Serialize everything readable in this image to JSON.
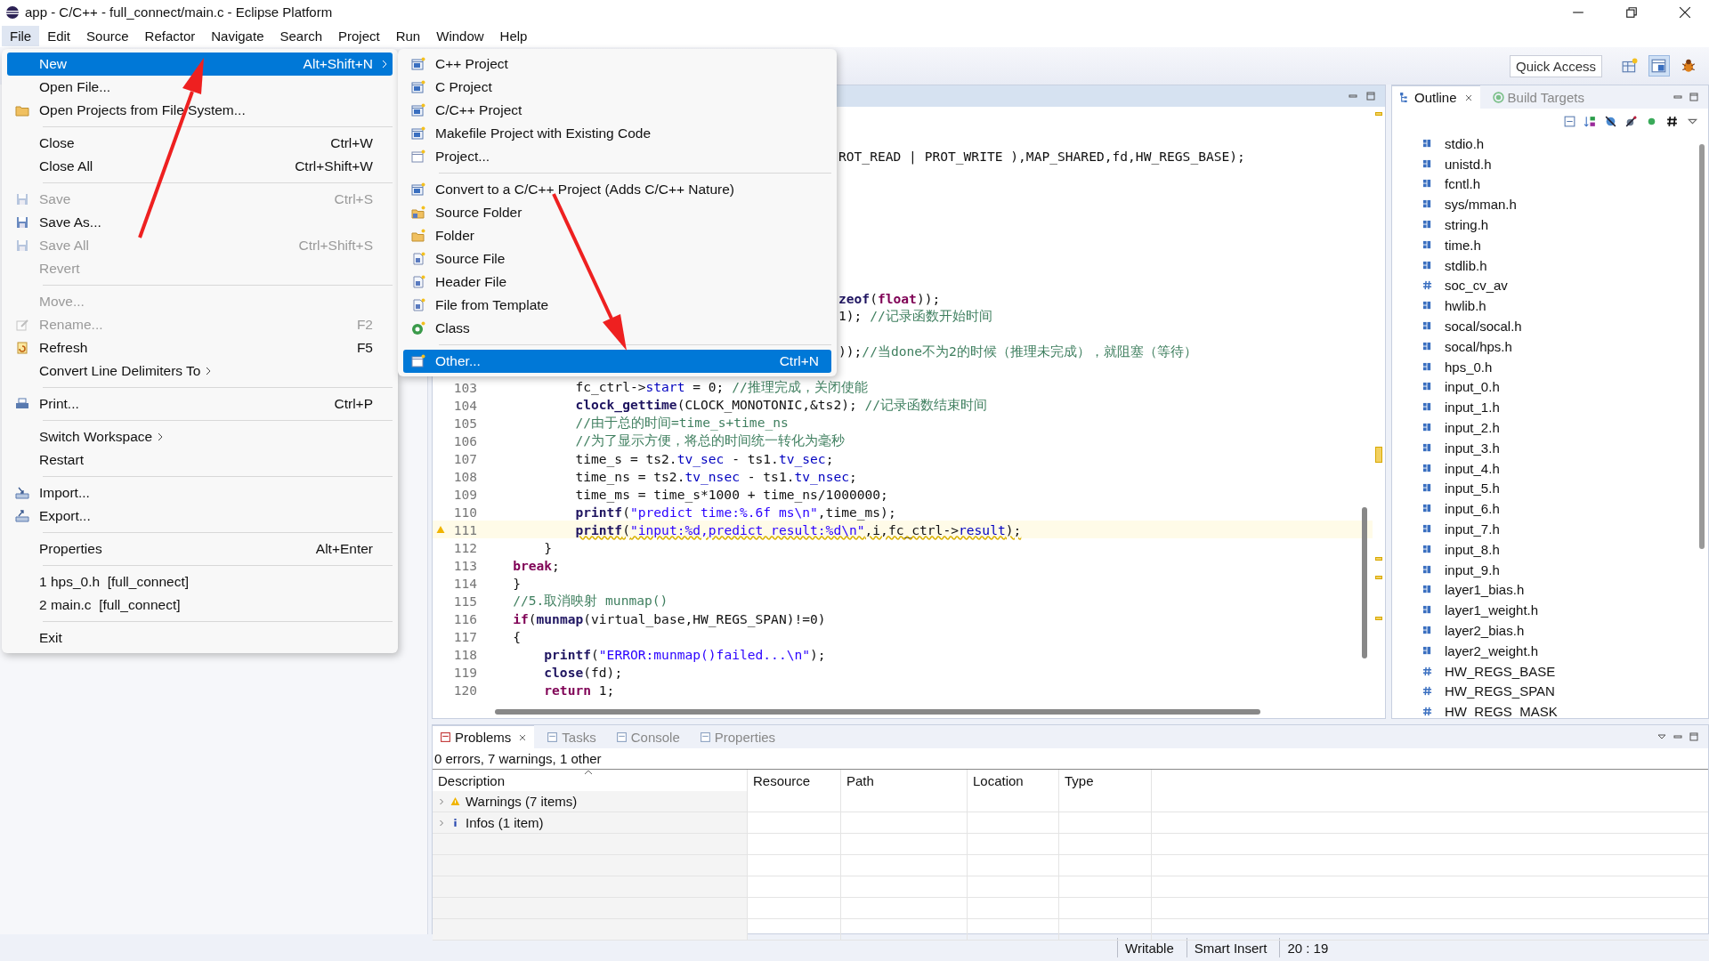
{
  "window": {
    "title": "app - C/C++ - full_connect/main.c - Eclipse Platform"
  },
  "menu_bar": [
    {
      "label": "File",
      "selected": true
    },
    {
      "label": "Edit",
      "selected": false
    },
    {
      "label": "Source",
      "selected": false
    },
    {
      "label": "Refactor",
      "selected": false
    },
    {
      "label": "Navigate",
      "selected": false
    },
    {
      "label": "Search",
      "selected": false
    },
    {
      "label": "Project",
      "selected": false
    },
    {
      "label": "Run",
      "selected": false
    },
    {
      "label": "Window",
      "selected": false
    },
    {
      "label": "Help",
      "selected": false
    }
  ],
  "toolbar": {
    "quick_access": "Quick Access"
  },
  "file_menu": [
    {
      "kind": "item",
      "label": "New",
      "shortcut": "Alt+Shift+N",
      "selected": true,
      "disabled": false,
      "has_submenu": true
    },
    {
      "kind": "item",
      "label": "Open File...",
      "selected": false,
      "disabled": false,
      "has_submenu": false
    },
    {
      "kind": "item",
      "label": "Open Projects from File System...",
      "selected": false,
      "disabled": false,
      "has_submenu": false
    },
    {
      "kind": "separator"
    },
    {
      "kind": "item",
      "label": "Close",
      "shortcut": "Ctrl+W",
      "selected": false,
      "disabled": false,
      "has_submenu": false
    },
    {
      "kind": "item",
      "label": "Close All",
      "shortcut": "Ctrl+Shift+W",
      "selected": false,
      "disabled": false,
      "has_submenu": false
    },
    {
      "kind": "separator"
    },
    {
      "kind": "item",
      "label": "Save",
      "shortcut": "Ctrl+S",
      "selected": false,
      "disabled": true,
      "has_submenu": false
    },
    {
      "kind": "item",
      "label": "Save As...",
      "selected": false,
      "disabled": false,
      "has_submenu": false
    },
    {
      "kind": "item",
      "label": "Save All",
      "shortcut": "Ctrl+Shift+S",
      "selected": false,
      "disabled": true,
      "has_submenu": false
    },
    {
      "kind": "item",
      "label": "Revert",
      "selected": false,
      "disabled": true,
      "has_submenu": false
    },
    {
      "kind": "separator"
    },
    {
      "kind": "item",
      "label": "Move...",
      "selected": false,
      "disabled": true,
      "has_submenu": false
    },
    {
      "kind": "item",
      "label": "Rename...",
      "shortcut": "F2",
      "selected": false,
      "disabled": true,
      "has_submenu": false
    },
    {
      "kind": "item",
      "label": "Refresh",
      "shortcut": "F5",
      "selected": false,
      "disabled": false,
      "has_submenu": false
    },
    {
      "kind": "item",
      "label": "Convert Line Delimiters To",
      "selected": false,
      "disabled": false,
      "has_submenu": true
    },
    {
      "kind": "separator"
    },
    {
      "kind": "item",
      "label": "Print...",
      "shortcut": "Ctrl+P",
      "selected": false,
      "disabled": false,
      "has_submenu": false
    },
    {
      "kind": "separator"
    },
    {
      "kind": "item",
      "label": "Switch Workspace",
      "selected": false,
      "disabled": false,
      "has_submenu": true
    },
    {
      "kind": "item",
      "label": "Restart",
      "selected": false,
      "disabled": false,
      "has_submenu": false
    },
    {
      "kind": "separator"
    },
    {
      "kind": "item",
      "label": "Import...",
      "selected": false,
      "disabled": false,
      "has_submenu": false
    },
    {
      "kind": "item",
      "label": "Export...",
      "selected": false,
      "disabled": false,
      "has_submenu": false
    },
    {
      "kind": "separator"
    },
    {
      "kind": "item",
      "label": "Properties",
      "shortcut": "Alt+Enter",
      "selected": false,
      "disabled": false,
      "has_submenu": false
    },
    {
      "kind": "separator"
    },
    {
      "kind": "item",
      "label": "1 hps_0.h  [full_connect]",
      "selected": false,
      "disabled": false,
      "has_submenu": false
    },
    {
      "kind": "item",
      "label": "2 main.c  [full_connect]",
      "selected": false,
      "disabled": false,
      "has_submenu": false
    },
    {
      "kind": "separator"
    },
    {
      "kind": "item",
      "label": "Exit",
      "selected": false,
      "disabled": false,
      "has_submenu": false
    }
  ],
  "new_submenu": [
    {
      "kind": "item",
      "label": "C++ Project",
      "selected": false
    },
    {
      "kind": "item",
      "label": "C Project",
      "selected": false
    },
    {
      "kind": "item",
      "label": "C/C++ Project",
      "selected": false
    },
    {
      "kind": "item",
      "label": "Makefile Project with Existing Code",
      "selected": false
    },
    {
      "kind": "item",
      "label": "Project...",
      "selected": false
    },
    {
      "kind": "separator"
    },
    {
      "kind": "item",
      "label": "Convert to a C/C++ Project (Adds C/C++ Nature)",
      "selected": false
    },
    {
      "kind": "item",
      "label": "Source Folder",
      "selected": false
    },
    {
      "kind": "item",
      "label": "Folder",
      "selected": false
    },
    {
      "kind": "item",
      "label": "Source File",
      "selected": false
    },
    {
      "kind": "item",
      "label": "Header File",
      "selected": false
    },
    {
      "kind": "item",
      "label": "File from Template",
      "selected": false
    },
    {
      "kind": "item",
      "label": "Class",
      "selected": false
    },
    {
      "kind": "separator"
    },
    {
      "kind": "item",
      "label": "Other...",
      "shortcut": "Ctrl+N",
      "selected": true
    }
  ],
  "editor": {
    "lines": [
      {
        "warning": false,
        "segments": [
          {
            "kind": "plain",
            "text": "ROT_READ | PROT_WRITE ),MAP_SHARED,fd,HW_REGS_BASE);"
          }
        ]
      },
      {
        "warning": false
      },
      {
        "warning": false
      },
      {
        "warning": false
      },
      {
        "warning": false
      },
      {
        "warning": false
      },
      {
        "warning": false
      },
      {
        "warning": false
      },
      {
        "warning": false,
        "segments": [
          {
            "kind": "function",
            "text": "zeof"
          },
          {
            "kind": "plain",
            "text": "("
          },
          {
            "kind": "keyword",
            "text": "float"
          },
          {
            "kind": "plain",
            "text": "));"
          }
        ]
      },
      {
        "warning": false,
        "segments": [
          {
            "kind": "plain",
            "text": "1); "
          },
          {
            "kind": "comment",
            "text": "//记录函数开始时间"
          }
        ]
      },
      {
        "warning": false
      },
      {
        "warning": false,
        "segments": [
          {
            "kind": "plain",
            "text": "));"
          },
          {
            "kind": "comment",
            "text": "//当done不为2的时候（推理未完成），就阻塞（等待）"
          }
        ]
      },
      {
        "warning": false
      },
      {
        "number": "103",
        "warning": false,
        "segments": [
          {
            "kind": "plain",
            "text": "\t\t\tfc_ctrl->"
          },
          {
            "kind": "field",
            "text": "start"
          },
          {
            "kind": "plain",
            "text": " = 0; "
          },
          {
            "kind": "comment",
            "text": "//推理完成，关闭使能"
          }
        ]
      },
      {
        "number": "104",
        "warning": false,
        "segments": [
          {
            "kind": "function",
            "text": "\t\t\tclock_gettime"
          },
          {
            "kind": "plain",
            "text": "(CLOCK_MONOTONIC,&ts2); "
          },
          {
            "kind": "comment",
            "text": "//记录函数结束时间"
          }
        ]
      },
      {
        "number": "105",
        "warning": false,
        "segments": [
          {
            "kind": "comment",
            "text": "\t\t\t//由于总的时间=time_s+time_ns"
          }
        ]
      },
      {
        "number": "106",
        "warning": false,
        "segments": [
          {
            "kind": "comment",
            "text": "\t\t\t//为了显示方便，将总的时间统一转化为毫秒"
          }
        ]
      },
      {
        "number": "107",
        "warning": false,
        "segments": [
          {
            "kind": "plain",
            "text": "\t\t\ttime_s = ts2."
          },
          {
            "kind": "field",
            "text": "tv_sec"
          },
          {
            "kind": "plain",
            "text": " - ts1."
          },
          {
            "kind": "field",
            "text": "tv_sec"
          },
          {
            "kind": "plain",
            "text": ";"
          }
        ]
      },
      {
        "number": "108",
        "warning": false,
        "segments": [
          {
            "kind": "plain",
            "text": "\t\t\ttime_ns = ts2."
          },
          {
            "kind": "field",
            "text": "tv_nsec"
          },
          {
            "kind": "plain",
            "text": " - ts1."
          },
          {
            "kind": "field",
            "text": "tv_nsec"
          },
          {
            "kind": "plain",
            "text": ";"
          }
        ]
      },
      {
        "number": "109",
        "warning": false,
        "segments": [
          {
            "kind": "plain",
            "text": "\t\t\ttime_ms = time_s*1000 + time_ns/1000000;"
          }
        ]
      },
      {
        "number": "110",
        "warning": false,
        "segments": [
          {
            "kind": "function",
            "text": "\t\t\tprintf"
          },
          {
            "kind": "plain",
            "text": "("
          },
          {
            "kind": "string",
            "text": "\"predict time:%.6f ms\\n\""
          },
          {
            "kind": "plain",
            "text": ",time_ms);"
          }
        ]
      },
      {
        "number": "111",
        "warning": true,
        "segments": [
          {
            "kind": "function",
            "text": "\t\t\tprintf"
          },
          {
            "kind": "plain",
            "text": "("
          },
          {
            "kind": "string",
            "text": "\"input:%d,predict result:%d\\n\""
          },
          {
            "kind": "plain",
            "text": ",i,fc_ctrl->"
          },
          {
            "kind": "field",
            "text": "result"
          },
          {
            "kind": "plain",
            "text": ");"
          }
        ]
      },
      {
        "number": "112",
        "warning": false,
        "segments": [
          {
            "kind": "plain",
            "text": "\t\t}"
          }
        ]
      },
      {
        "number": "113",
        "warning": false,
        "segments": [
          {
            "kind": "keyword",
            "text": "\tbreak"
          },
          {
            "kind": "plain",
            "text": ";"
          }
        ]
      },
      {
        "number": "114",
        "warning": false,
        "segments": [
          {
            "kind": "plain",
            "text": "\t}"
          }
        ]
      },
      {
        "number": "115",
        "warning": false,
        "segments": [
          {
            "kind": "comment",
            "text": "\t//5.取消映射 munmap()"
          }
        ]
      },
      {
        "number": "116",
        "warning": false,
        "segments": [
          {
            "kind": "keyword",
            "text": "\tif"
          },
          {
            "kind": "plain",
            "text": "("
          },
          {
            "kind": "function",
            "text": "munmap"
          },
          {
            "kind": "plain",
            "text": "(virtual_base,HW_REGS_SPAN)!=0)"
          }
        ]
      },
      {
        "number": "117",
        "warning": false,
        "segments": [
          {
            "kind": "plain",
            "text": "\t{"
          }
        ]
      },
      {
        "number": "118",
        "warning": false,
        "segments": [
          {
            "kind": "function",
            "text": "\t\tprintf"
          },
          {
            "kind": "plain",
            "text": "("
          },
          {
            "kind": "string",
            "text": "\"ERROR:munmap()failed...\\n\""
          },
          {
            "kind": "plain",
            "text": ");"
          }
        ]
      },
      {
        "number": "119",
        "warning": false,
        "segments": [
          {
            "kind": "function",
            "text": "\t\tclose"
          },
          {
            "kind": "plain",
            "text": "(fd);"
          }
        ]
      },
      {
        "number": "120",
        "warning": false,
        "segments": [
          {
            "kind": "keyword",
            "text": "\t\treturn"
          },
          {
            "kind": "plain",
            "text": " 1;"
          }
        ]
      }
    ]
  },
  "outline": {
    "tabs": [
      {
        "label": "Outline",
        "selected": true
      },
      {
        "label": "Build Targets",
        "selected": false
      }
    ],
    "items": [
      {
        "label": "stdio.h",
        "kind": "include"
      },
      {
        "label": "unistd.h",
        "kind": "include"
      },
      {
        "label": "fcntl.h",
        "kind": "include"
      },
      {
        "label": "sys/mman.h",
        "kind": "include"
      },
      {
        "label": "string.h",
        "kind": "include"
      },
      {
        "label": "time.h",
        "kind": "include"
      },
      {
        "label": "stdlib.h",
        "kind": "include"
      },
      {
        "label": "soc_cv_av",
        "kind": "macro"
      },
      {
        "label": "hwlib.h",
        "kind": "include"
      },
      {
        "label": "socal/socal.h",
        "kind": "include"
      },
      {
        "label": "socal/hps.h",
        "kind": "include"
      },
      {
        "label": "hps_0.h",
        "kind": "include"
      },
      {
        "label": "input_0.h",
        "kind": "include"
      },
      {
        "label": "input_1.h",
        "kind": "include"
      },
      {
        "label": "input_2.h",
        "kind": "include"
      },
      {
        "label": "input_3.h",
        "kind": "include"
      },
      {
        "label": "input_4.h",
        "kind": "include"
      },
      {
        "label": "input_5.h",
        "kind": "include"
      },
      {
        "label": "input_6.h",
        "kind": "include"
      },
      {
        "label": "input_7.h",
        "kind": "include"
      },
      {
        "label": "input_8.h",
        "kind": "include"
      },
      {
        "label": "input_9.h",
        "kind": "include"
      },
      {
        "label": "layer1_bias.h",
        "kind": "include"
      },
      {
        "label": "layer1_weight.h",
        "kind": "include"
      },
      {
        "label": "layer2_bias.h",
        "kind": "include"
      },
      {
        "label": "layer2_weight.h",
        "kind": "include"
      },
      {
        "label": "HW_REGS_BASE",
        "kind": "macro"
      },
      {
        "label": "HW_REGS_SPAN",
        "kind": "macro"
      },
      {
        "label": "HW_REGS_MASK",
        "kind": "macro"
      }
    ]
  },
  "problems": {
    "tabs": [
      {
        "label": "Problems",
        "selected": true
      },
      {
        "label": "Tasks",
        "selected": false
      },
      {
        "label": "Console",
        "selected": false
      },
      {
        "label": "Properties",
        "selected": false
      }
    ],
    "summary": "0 errors, 7 warnings, 1 other",
    "columns": [
      "Description",
      "Resource",
      "Path",
      "Location",
      "Type"
    ],
    "rows": [
      {
        "label": "Warnings (7 items)",
        "kind": "warning",
        "expanded": false
      },
      {
        "label": "Infos (1 item)",
        "kind": "info",
        "expanded": false
      }
    ]
  },
  "status_bar": [
    "Writable",
    "Smart Insert",
    "20 : 19"
  ]
}
